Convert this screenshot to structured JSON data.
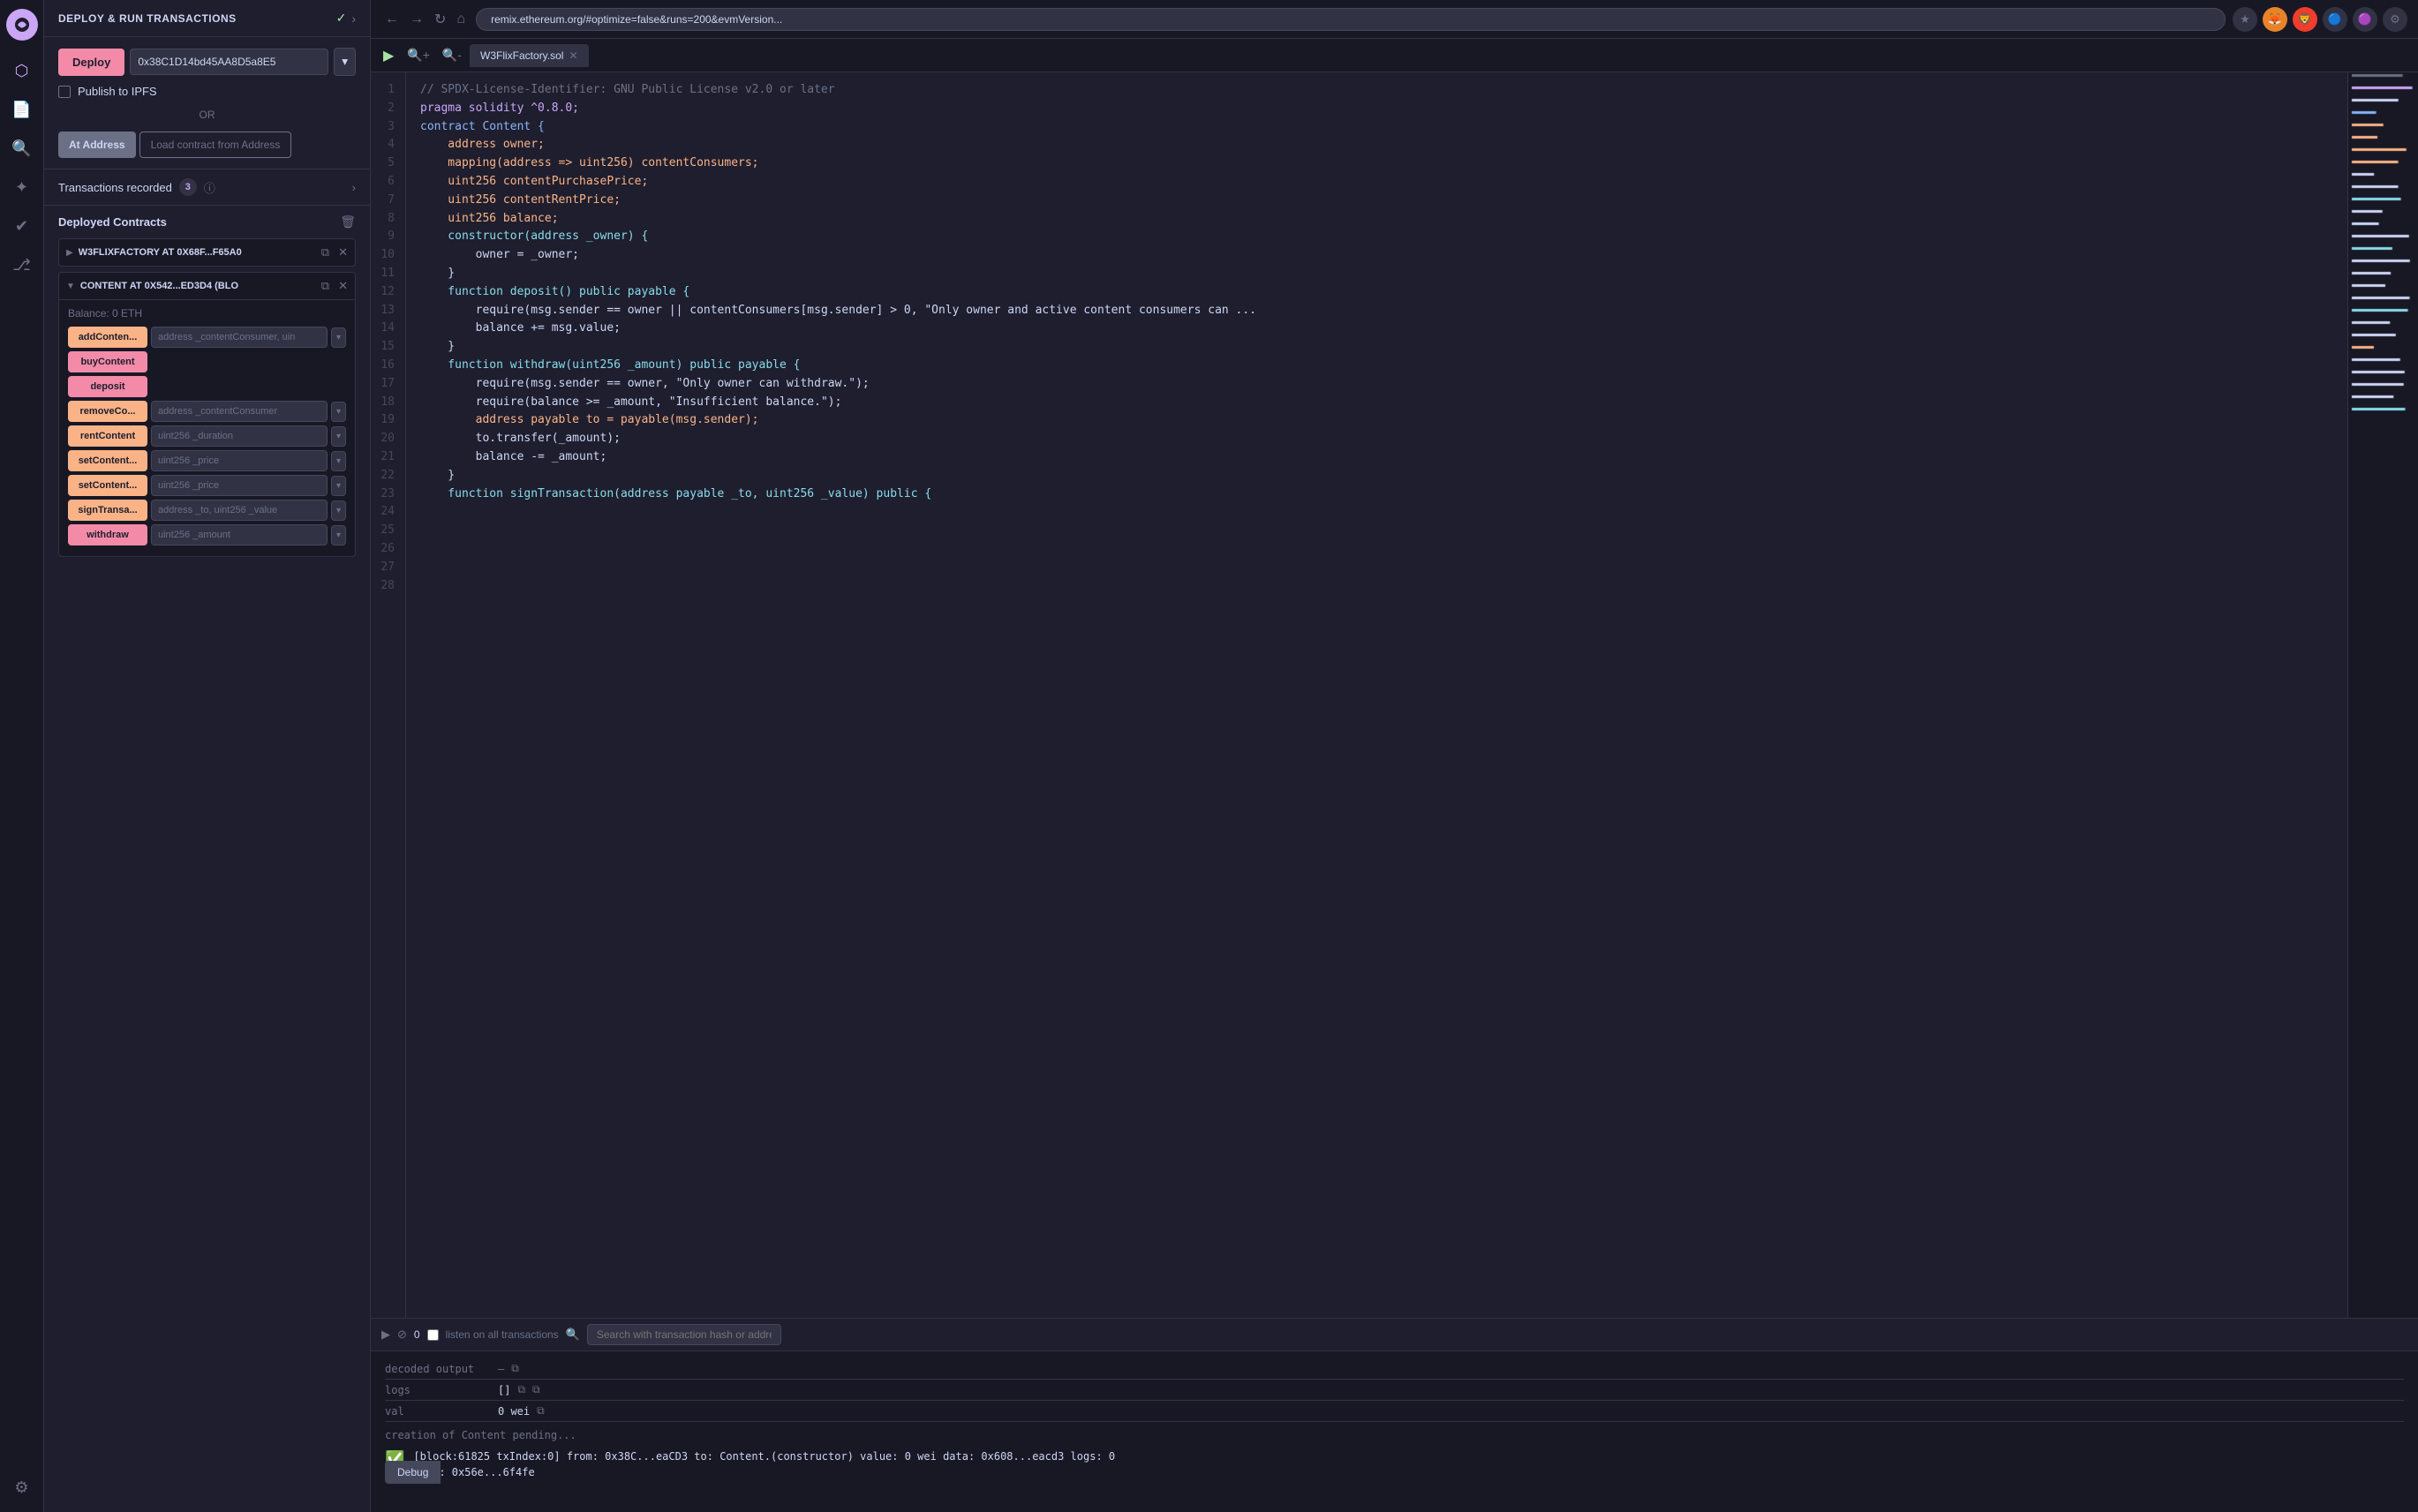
{
  "appTitle": "DEPLOY & RUN TRANSACTIONS",
  "iconBar": {
    "icons": [
      "◎",
      "⊞",
      "🔍",
      "●",
      "✦",
      "⚙"
    ]
  },
  "sidebar": {
    "deployBtn": "Deploy",
    "deployAddress": "0x38C1D14bd45AA8D5a8E5",
    "publishToIPFS": "Publish to IPFS",
    "orDivider": "OR",
    "atAddressBtn": "At Address",
    "loadContractBtn": "Load contract from Address",
    "transactionsLabel": "Transactions recorded",
    "txCount": "3",
    "deployedContractsTitle": "Deployed Contracts",
    "contracts": [
      {
        "name": "W3FLIXFACTORY AT 0X68F...F65A0",
        "collapsed": true
      },
      {
        "name": "CONTENT AT 0X542...ED3D4 (BLO",
        "collapsed": false,
        "balance": "Balance: 0 ETH",
        "functions": [
          {
            "label": "addConten...",
            "input": "address _contentConsumer, uin",
            "type": "orange",
            "hasDropdown": true
          },
          {
            "label": "buyContent",
            "input": null,
            "type": "red",
            "hasDropdown": false
          },
          {
            "label": "deposit",
            "input": null,
            "type": "red",
            "hasDropdown": false
          },
          {
            "label": "removeCo...",
            "input": "address _contentConsumer",
            "type": "orange",
            "hasDropdown": true
          },
          {
            "label": "rentContent",
            "input": "uint256 _duration",
            "type": "orange",
            "hasDropdown": true
          },
          {
            "label": "setContent...",
            "input": "uint256 _price",
            "type": "orange",
            "hasDropdown": true
          },
          {
            "label": "setContent...",
            "input": "uint256 _price",
            "type": "orange",
            "hasDropdown": true
          },
          {
            "label": "signTransa...",
            "input": "address _to, uint256 _value",
            "type": "orange",
            "hasDropdown": true
          },
          {
            "label": "withdraw",
            "input": "uint256 _amount",
            "type": "red",
            "hasDropdown": true
          }
        ]
      }
    ]
  },
  "editor": {
    "tabLabel": "W3FlixFactory.sol",
    "lines": [
      {
        "num": 1,
        "code": "// SPDX-License-Identifier: GNU Public License v2.0 or later",
        "cls": "kw-comment"
      },
      {
        "num": 2,
        "code": "pragma solidity ^0.8.0;",
        "cls": "kw-pragma"
      },
      {
        "num": 3,
        "code": "",
        "cls": "kw-plain"
      },
      {
        "num": 4,
        "code": "contract Content {",
        "cls": "kw-contract"
      },
      {
        "num": 5,
        "code": "    address owner;",
        "cls": "kw-type"
      },
      {
        "num": 6,
        "code": "    mapping(address => uint256) contentConsumers;",
        "cls": "kw-type"
      },
      {
        "num": 7,
        "code": "    uint256 contentPurchasePrice;",
        "cls": "kw-type"
      },
      {
        "num": 8,
        "code": "    uint256 contentRentPrice;",
        "cls": "kw-type"
      },
      {
        "num": 9,
        "code": "    uint256 balance;",
        "cls": "kw-type"
      },
      {
        "num": 10,
        "code": "",
        "cls": "kw-plain"
      },
      {
        "num": 11,
        "code": "    constructor(address _owner) {",
        "cls": "kw-fn"
      },
      {
        "num": 12,
        "code": "        owner = _owner;",
        "cls": "kw-plain"
      },
      {
        "num": 13,
        "code": "    }",
        "cls": "kw-plain"
      },
      {
        "num": 14,
        "code": "",
        "cls": "kw-plain"
      },
      {
        "num": 15,
        "code": "    function deposit() public payable {",
        "cls": "kw-fn"
      },
      {
        "num": 16,
        "code": "        require(msg.sender == owner || contentConsumers[msg.sender] > 0, \"Only owner and active content consumers can ...",
        "cls": "kw-plain"
      },
      {
        "num": 17,
        "code": "        balance += msg.value;",
        "cls": "kw-plain"
      },
      {
        "num": 18,
        "code": "    }",
        "cls": "kw-plain"
      },
      {
        "num": 19,
        "code": "",
        "cls": "kw-plain"
      },
      {
        "num": 20,
        "code": "    function withdraw(uint256 _amount) public payable {",
        "cls": "kw-fn"
      },
      {
        "num": 21,
        "code": "        require(msg.sender == owner, \"Only owner can withdraw.\");",
        "cls": "kw-plain"
      },
      {
        "num": 22,
        "code": "        require(balance >= _amount, \"Insufficient balance.\");",
        "cls": "kw-plain"
      },
      {
        "num": 23,
        "code": "        address payable to = payable(msg.sender);",
        "cls": "kw-type"
      },
      {
        "num": 24,
        "code": "        to.transfer(_amount);",
        "cls": "kw-plain"
      },
      {
        "num": 25,
        "code": "        balance -= _amount;",
        "cls": "kw-plain"
      },
      {
        "num": 26,
        "code": "    }",
        "cls": "kw-plain"
      },
      {
        "num": 27,
        "code": "",
        "cls": "kw-plain"
      },
      {
        "num": 28,
        "code": "    function signTransaction(address payable _to, uint256 _value) public {",
        "cls": "kw-fn"
      }
    ]
  },
  "bottomPanel": {
    "txCount": "0",
    "listenLabel": "listen on all transactions",
    "searchPlaceholder": "Search with transaction hash or address",
    "decodedOutput": "decoded output",
    "decodedDash": "–",
    "logsLabel": "logs",
    "logsVal": "[]",
    "valLabel": "val",
    "valVal": "0 wei",
    "pendingMsg": "creation of Content pending...",
    "successBlock": "[block:61825 txIndex:0] from: 0x38C...eaCD3 to: Content.(constructor) value: 0 wei data: 0x608...eacd3 logs: 0",
    "successHash": "hash: 0x56e...6f4fe",
    "debugBtn": "Debug",
    "urlBar": "remix.ethereum.org/#optimize=false&runs=200&evmVersion..."
  }
}
